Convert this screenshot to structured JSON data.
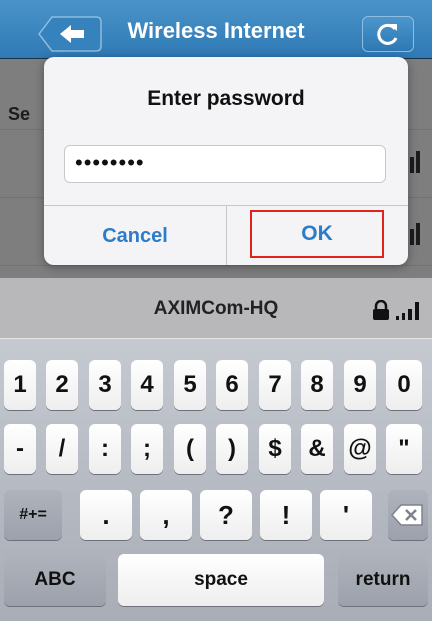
{
  "nav": {
    "title": "Wireless Internet",
    "back_icon": "back-arrow-icon",
    "refresh_icon": "refresh-icon"
  },
  "section": {
    "label_partial": "Se"
  },
  "networks": [
    {
      "name": "AXIMCom-HQ",
      "secured": true
    }
  ],
  "dialog": {
    "title": "Enter password",
    "password_value": "••••••••",
    "cancel_label": "Cancel",
    "ok_label": "OK",
    "highlight_color": "#e0231c",
    "button_color": "#2c7cc9"
  },
  "keyboard": {
    "row1": [
      "1",
      "2",
      "3",
      "4",
      "5",
      "6",
      "7",
      "8",
      "9",
      "0"
    ],
    "row2": [
      "-",
      "/",
      ":",
      ";",
      "(",
      ")",
      "$",
      "&",
      "@",
      "\""
    ],
    "row3": [
      "#+=",
      ".",
      ",",
      "?",
      "!",
      "'"
    ],
    "row4": {
      "abc": "ABC",
      "space": "space",
      "return": "return"
    },
    "backspace_icon": "backspace-icon"
  },
  "colors": {
    "nav": "#3a86c0",
    "keyboard": "#b7bbc3"
  }
}
